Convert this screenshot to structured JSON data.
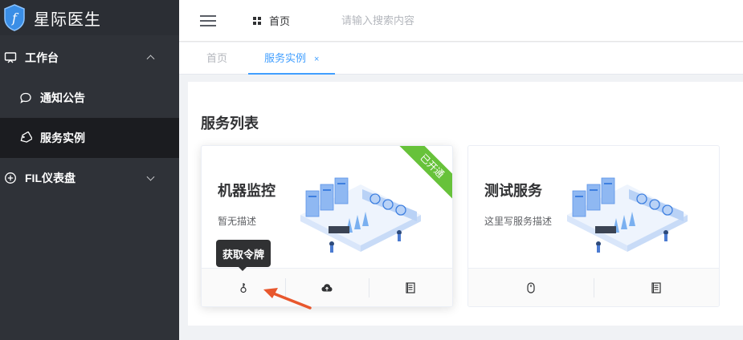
{
  "brand": {
    "name": "星际医生",
    "logo_letter": "f"
  },
  "sidebar": {
    "items": [
      {
        "label": "工作台",
        "icon": "monitor-icon",
        "expanded": true
      },
      {
        "label": "通知公告",
        "icon": "chat-bubble-icon"
      },
      {
        "label": "服务实例",
        "icon": "tag-icon",
        "active": true
      },
      {
        "label": "FIL仪表盘",
        "icon": "plus-circle-icon",
        "expanded": false
      }
    ]
  },
  "header": {
    "home_label": "首页",
    "search_placeholder": "请输入搜索内容"
  },
  "tabs": [
    {
      "label": "首页"
    },
    {
      "label": "服务实例",
      "active": true,
      "close": "×"
    }
  ],
  "section_title": "服务列表",
  "cards": [
    {
      "title": "机器监控",
      "description": "暂无描述",
      "badge": "已开通",
      "actions": [
        "key-icon",
        "cloud-upload-icon",
        "document-icon"
      ]
    },
    {
      "title": "测试服务",
      "description": "这里写服务描述",
      "actions": [
        "mouse-icon",
        "document-icon"
      ]
    }
  ],
  "tooltip": {
    "text": "获取令牌"
  },
  "colors": {
    "sidebar_bg": "#2f3238",
    "accent": "#409eff",
    "badge": "#67c23a",
    "annotation": "#e8572d"
  }
}
